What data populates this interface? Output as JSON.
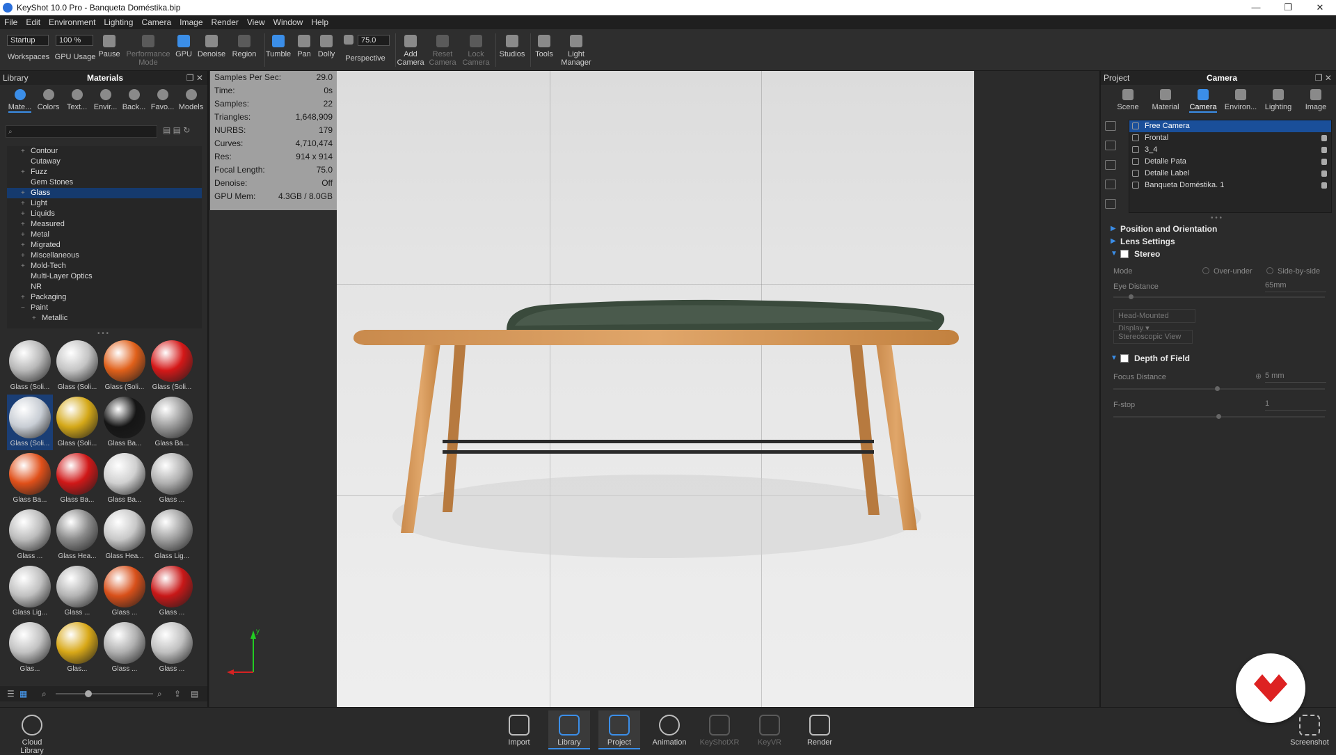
{
  "window": {
    "title": "KeyShot 10.0 Pro - Banqueta Doméstika.bip",
    "controls": [
      "—",
      "❐",
      "✕"
    ]
  },
  "menu": [
    "File",
    "Edit",
    "Environment",
    "Lighting",
    "Camera",
    "Image",
    "Render",
    "View",
    "Window",
    "Help"
  ],
  "toolbar": {
    "workspace_value": "Startup",
    "workspaces_label": "Workspaces",
    "gpu_usage_value": "100 %",
    "gpu_usage_label": "GPU Usage",
    "pause_label": "Pause",
    "performance_label": "Performance Mode",
    "gpu_label": "GPU",
    "denoise_label": "Denoise",
    "region_label": "Region",
    "tumble_label": "Tumble",
    "pan_label": "Pan",
    "dolly_label": "Dolly",
    "focal_value": "75.0",
    "perspective_label": "Perspective",
    "add_camera_label": "Add Camera",
    "reset_camera_label": "Reset Camera",
    "lock_camera_label": "Lock Camera",
    "studios_label": "Studios",
    "tools_label": "Tools",
    "light_manager_label": "Light Manager"
  },
  "library": {
    "panel_label": "Library",
    "title": "Materials",
    "tabs": [
      "Mate...",
      "Colors",
      "Text...",
      "Envir...",
      "Back...",
      "Favo...",
      "Models"
    ],
    "tree": [
      {
        "label": "Contour",
        "exp": "+"
      },
      {
        "label": "Cutaway",
        "exp": ""
      },
      {
        "label": "Fuzz",
        "exp": "+"
      },
      {
        "label": "Gem Stones",
        "exp": ""
      },
      {
        "label": "Glass",
        "exp": "+"
      },
      {
        "label": "Light",
        "exp": "+"
      },
      {
        "label": "Liquids",
        "exp": "+"
      },
      {
        "label": "Measured",
        "exp": "+"
      },
      {
        "label": "Metal",
        "exp": "+"
      },
      {
        "label": "Migrated",
        "exp": "+"
      },
      {
        "label": "Miscellaneous",
        "exp": "+"
      },
      {
        "label": "Mold-Tech",
        "exp": "+"
      },
      {
        "label": "Multi-Layer Optics",
        "exp": ""
      },
      {
        "label": "NR",
        "exp": ""
      },
      {
        "label": "Packaging",
        "exp": "+"
      },
      {
        "label": "Paint",
        "exp": "−"
      },
      {
        "label": "Metallic",
        "exp": "+"
      }
    ],
    "thumbnails": [
      {
        "label": "Glass (Soli...",
        "color": "#b8b8b8"
      },
      {
        "label": "Glass (Soli...",
        "color": "#c4c4c4"
      },
      {
        "label": "Glass (Soli...",
        "color": "#e0601a"
      },
      {
        "label": "Glass (Soli...",
        "color": "#d41818"
      },
      {
        "label": "Glass (Soli...",
        "color": "#c8cdd4"
      },
      {
        "label": "Glass (Soli...",
        "color": "#d4a818"
      },
      {
        "label": "Glass Ba...",
        "color": "#151515"
      },
      {
        "label": "Glass Ba...",
        "color": "#9a9a9a"
      },
      {
        "label": "Glass Ba...",
        "color": "#e0501a"
      },
      {
        "label": "Glass Ba...",
        "color": "#d01818"
      },
      {
        "label": "Glass Ba...",
        "color": "#d0d0d0"
      },
      {
        "label": "Glass ...",
        "color": "#b0b0b0"
      },
      {
        "label": "Glass ...",
        "color": "#bcbcbc"
      },
      {
        "label": "Glass Hea...",
        "color": "#8a8a8a"
      },
      {
        "label": "Glass Hea...",
        "color": "#c8c8c8"
      },
      {
        "label": "Glass Lig...",
        "color": "#a0a0a0"
      },
      {
        "label": "Glass Lig...",
        "color": "#c0c0c0"
      },
      {
        "label": "Glass ...",
        "color": "#b4b4b4"
      },
      {
        "label": "Glass ...",
        "color": "#d8501a"
      },
      {
        "label": "Glass ...",
        "color": "#c81818"
      },
      {
        "label": "Glas...",
        "color": "#c2c2c2"
      },
      {
        "label": "Glas...",
        "color": "#d8a818"
      },
      {
        "label": "Glass ...",
        "color": "#b0b0b0"
      },
      {
        "label": "Glass ...",
        "color": "#c0c0c0"
      }
    ]
  },
  "hud": [
    {
      "label": "Samples Per Sec:",
      "value": "29.0"
    },
    {
      "label": "Time:",
      "value": "0s"
    },
    {
      "label": "Samples:",
      "value": "22"
    },
    {
      "label": "Triangles:",
      "value": "1,648,909"
    },
    {
      "label": "NURBS:",
      "value": "179"
    },
    {
      "label": "Curves:",
      "value": "4,710,474"
    },
    {
      "label": "Res:",
      "value": "914 x 914"
    },
    {
      "label": "Focal Length:",
      "value": "75.0"
    },
    {
      "label": "Denoise:",
      "value": "Off"
    },
    {
      "label": "GPU Mem:",
      "value": "4.3GB / 8.0GB"
    }
  ],
  "axis": {
    "y": "y"
  },
  "project": {
    "panel_label": "Project",
    "title": "Camera",
    "tabs": [
      "Scene",
      "Material",
      "Camera",
      "Environ...",
      "Lighting",
      "Image"
    ],
    "cameras": [
      {
        "label": "Free Camera",
        "locked": false
      },
      {
        "label": "Frontal",
        "locked": true
      },
      {
        "label": "3_4",
        "locked": true
      },
      {
        "label": "Detalle Pata",
        "locked": true
      },
      {
        "label": "Detalle Label",
        "locked": true
      },
      {
        "label": "Banqueta Doméstika. 1",
        "locked": true
      }
    ],
    "sections": {
      "position": "Position and Orientation",
      "lens": "Lens Settings",
      "stereo": "Stereo",
      "dof": "Depth of Field"
    },
    "stereo": {
      "mode_label": "Mode",
      "over_under": "Over-under",
      "side_by_side": "Side-by-side",
      "eye_distance_label": "Eye Distance",
      "eye_distance_value": "65mm",
      "hmd_label": "Head-Mounted Display",
      "stereoscopic_label": "Stereoscopic View"
    },
    "dof": {
      "focus_label": "Focus Distance",
      "focus_value": "5 mm",
      "fstop_label": "F-stop",
      "fstop_value": "1"
    }
  },
  "bottom": {
    "cloud_library": "Cloud Library",
    "import": "Import",
    "library": "Library",
    "project": "Project",
    "animation": "Animation",
    "keyshotxr": "KeyShotXR",
    "keyvr": "KeyVR",
    "render": "Render",
    "screenshot": "Screenshot"
  }
}
